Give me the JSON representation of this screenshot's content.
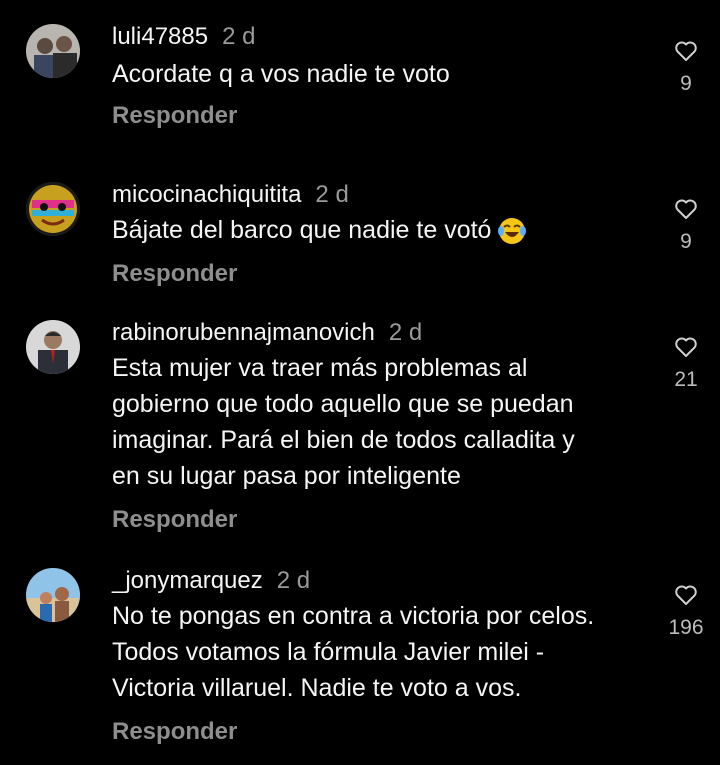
{
  "comments": [
    {
      "user": "luli47885",
      "time": "2 d",
      "text": "Acordate q a vos nadie te voto",
      "reply": "Responder",
      "likes": "9"
    },
    {
      "user": "micocinachiquitita",
      "time": "2 d",
      "text": "Bájate del barco que nadie te votó",
      "reply": "Responder",
      "likes": "9"
    },
    {
      "user": "rabinorubennajmanovich",
      "time": "2 d",
      "text_lines": [
        "Esta mujer va traer más problemas al",
        "gobierno que todo aquello que se puedan",
        "imaginar. Pará el bien de todos calladita y",
        "en su lugar pasa por inteligente"
      ],
      "reply": "Responder",
      "likes": "21"
    },
    {
      "user": "_jonymarquez",
      "time": "2 d",
      "text_lines": [
        "No te pongas en contra a victoria por celos.",
        "Todos votamos la fórmula Javier milei -",
        "Victoria villaruel. Nadie te voto a vos."
      ],
      "reply": "Responder",
      "likes": "196"
    }
  ],
  "icons": {
    "like": "heart-icon",
    "emoji": "face-with-tears-of-joy-icon"
  }
}
